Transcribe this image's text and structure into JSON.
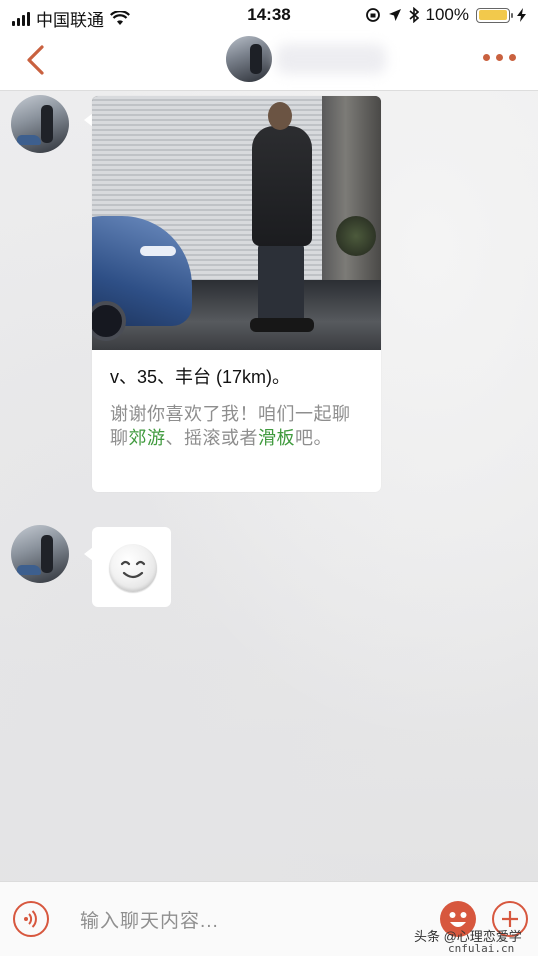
{
  "status_bar": {
    "carrier": "中国联通",
    "time": "14:38",
    "battery_percent": "100%",
    "battery_level": 1.0
  },
  "nav": {
    "back_icon": "chevron-left-icon",
    "more_icon": "more-dots-icon",
    "accent_color": "#c9613f"
  },
  "messages": [
    {
      "type": "profile-card",
      "summary": "v、35、丰台 (17km)。",
      "greeting_parts": [
        "谢谢你喜欢了我！咱们一起聊聊",
        "郊游",
        "、",
        "摇滚",
        "或者",
        "滑板",
        "吧。"
      ]
    },
    {
      "type": "emoji",
      "emoji": "smiley"
    }
  ],
  "input_bar": {
    "placeholder": "输入聊天内容...",
    "voice_icon": "voice-icon",
    "emoji_icon": "emoji-icon",
    "plus_icon": "plus-icon"
  },
  "watermark": {
    "line1": "头条 @心理恋爱学",
    "line2": "cnfulai.cn"
  }
}
